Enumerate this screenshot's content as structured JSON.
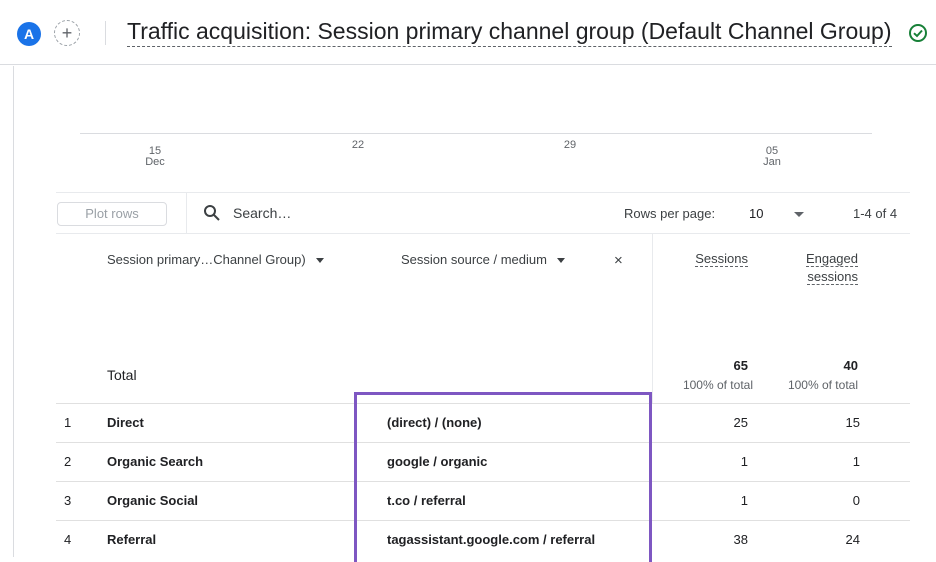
{
  "header": {
    "avatar_letter": "A",
    "add_symbol": "+",
    "title": "Traffic acquisition: Session primary channel group (Default Channel Group)"
  },
  "chart": {
    "x_ticks": [
      {
        "line1": "15",
        "line2": "Dec"
      },
      {
        "line1": "22",
        "line2": ""
      },
      {
        "line1": "29",
        "line2": ""
      },
      {
        "line1": "05",
        "line2": "Jan"
      }
    ]
  },
  "toolbar": {
    "plot_rows_label": "Plot rows",
    "search_placeholder": "Search…",
    "rows_per_page_label": "Rows per page:",
    "rows_per_page_value": "10",
    "pagination": "1-4 of 4"
  },
  "table": {
    "columns": {
      "dimension1": "Session primary…Channel Group)",
      "dimension2": "Session source / medium",
      "remove_symbol": "×",
      "sessions": "Sessions",
      "engaged_line1": "Engaged",
      "engaged_line2": "sessions"
    },
    "total": {
      "label": "Total",
      "sessions": "65",
      "sessions_pct": "100% of total",
      "engaged": "40",
      "engaged_pct": "100% of total"
    },
    "rows": [
      {
        "num": "1",
        "channel": "Direct",
        "source": "(direct) / (none)",
        "sessions": "25",
        "engaged": "15"
      },
      {
        "num": "2",
        "channel": "Organic Search",
        "source": "google / organic",
        "sessions": "1",
        "engaged": "1"
      },
      {
        "num": "3",
        "channel": "Organic Social",
        "source": "t.co / referral",
        "sessions": "1",
        "engaged": "0"
      },
      {
        "num": "4",
        "channel": "Referral",
        "source": "tagassistant.google.com / referral",
        "sessions": "38",
        "engaged": "24"
      }
    ]
  },
  "colors": {
    "accent": "#1a73e8",
    "highlight": "#7e57c2",
    "check": "#188038"
  }
}
